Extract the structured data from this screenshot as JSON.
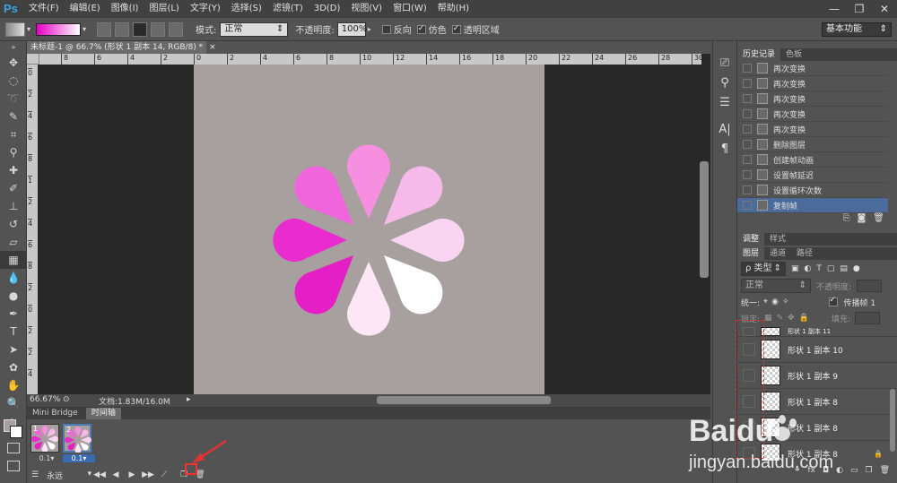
{
  "app": {
    "logo": "Ps"
  },
  "menu": [
    "文件(F)",
    "编辑(E)",
    "图像(I)",
    "图层(L)",
    "文字(Y)",
    "选择(S)",
    "滤镜(T)",
    "3D(D)",
    "视图(V)",
    "窗口(W)",
    "帮助(H)"
  ],
  "window": {
    "minimize": "—",
    "restore": "❐",
    "close": "✕"
  },
  "options": {
    "mode_label": "模式:",
    "mode_value": "正常",
    "opacity_label": "不透明度:",
    "opacity_value": "100%",
    "reverse": "反向",
    "dither": "仿色",
    "transparency": "透明区域",
    "reverse_checked": false,
    "dither_checked": true,
    "transparency_checked": true
  },
  "workspace_switcher": "基本功能",
  "document": {
    "tab_title": "未标题-1 @ 66.7% (形状 1 副本 14, RGB/8) *",
    "zoom": "66.67%",
    "doc_info": "文档:1.83M/16.0M",
    "ruler_h_ticks": [
      "8",
      "6",
      "4",
      "2",
      "0",
      "2",
      "4",
      "6",
      "8",
      "10",
      "12",
      "14",
      "16",
      "18",
      "20",
      "22",
      "24",
      "26",
      "28",
      "30"
    ],
    "ruler_v_ticks": [
      "0",
      "2",
      "4",
      "6",
      "8",
      "1",
      "2",
      "4",
      "6",
      "8",
      "2",
      "0",
      "2",
      "2",
      "4"
    ]
  },
  "flower": {
    "petals": [
      {
        "angle": 0,
        "color": "#f78fe0"
      },
      {
        "angle": 45,
        "color": "#f5b9ea"
      },
      {
        "angle": 90,
        "color": "#fad5f1"
      },
      {
        "angle": 135,
        "color": "#ffffff"
      },
      {
        "angle": 180,
        "color": "#fde6f6"
      },
      {
        "angle": 225,
        "color": "#e41fc6"
      },
      {
        "angle": 270,
        "color": "#ea2bd0"
      },
      {
        "angle": 315,
        "color": "#f165dc"
      }
    ]
  },
  "timeline": {
    "tabs": [
      "Mini Bridge",
      "时间轴"
    ],
    "active_tab": 1,
    "frames": [
      {
        "num": "1",
        "delay": "0.1▾"
      },
      {
        "num": "2",
        "delay": "0.1▾"
      }
    ],
    "active_frame": 1,
    "loop": "永远"
  },
  "history": {
    "tabs": [
      "历史记录",
      "色板"
    ],
    "items": [
      "再次变换",
      "再次变换",
      "再次变换",
      "再次变换",
      "再次变换",
      "删除图层",
      "创建帧动画",
      "设置帧延迟",
      "设置循环次数",
      "复制帧"
    ],
    "active_index": 9
  },
  "adjust_tabs": [
    "调整",
    "样式"
  ],
  "layers": {
    "tabs": [
      "图层",
      "通道",
      "路径"
    ],
    "kind_filter": "ρ 类型",
    "blend_mode": "正常",
    "opacity_label": "不透明度:",
    "unify_label": "统一:",
    "propagate_label": "传播帧 1",
    "lock_label": "锁定:",
    "fill_label": "填充:",
    "rows": [
      {
        "name": "形状 1 副本 11",
        "lock": ""
      },
      {
        "name": "形状 1 副本 10",
        "lock": ""
      },
      {
        "name": "形状 1 副本 9",
        "lock": ""
      },
      {
        "name": "形状 1 副本 8",
        "lock": ""
      },
      {
        "name": "形状 1 副本 8",
        "lock": ""
      },
      {
        "name": "形状 1 副本 8",
        "lock": "🔒"
      }
    ]
  },
  "watermark": {
    "brand": "Baidu",
    "url": "jingyan.baidu.com"
  },
  "colors": {
    "accent": "#4b6b9a",
    "annotation": "#e33333",
    "canvas_bg": "#a89f9f"
  }
}
